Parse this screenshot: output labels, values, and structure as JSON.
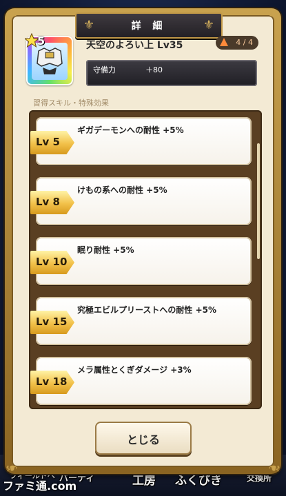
{
  "dialog": {
    "title": "詳 細",
    "close_label": "とじる"
  },
  "item": {
    "rarity": "5",
    "name": "天空のよろい上 Lv35",
    "page": "4 / 4",
    "stat_label": "守備力",
    "stat_value": "＋80"
  },
  "section_title": "習得スキル・特殊効果",
  "skills": [
    {
      "level": "Lv 5",
      "text": "ギガデーモンへの耐性 +5%"
    },
    {
      "level": "Lv 8",
      "text": "けもの系への耐性 +5%"
    },
    {
      "level": "Lv 10",
      "text": "眠り耐性 +5%"
    },
    {
      "level": "Lv 15",
      "text": "究極エビルプリーストへの耐性 +5%"
    },
    {
      "level": "Lv 18",
      "text": "メラ属性とくぎダメージ +3%"
    }
  ],
  "background_nav": {
    "items": [
      "フィールドへ",
      "パーティ",
      "工房",
      "ふくびき",
      "交換所"
    ]
  },
  "watermark": "ファミ通.com",
  "colors": {
    "frame_gold": "#c9a24e",
    "panel_brown": "#5a3f22",
    "badge_gold": "#f2c14a",
    "dialog_bg": "#f3ead4"
  }
}
